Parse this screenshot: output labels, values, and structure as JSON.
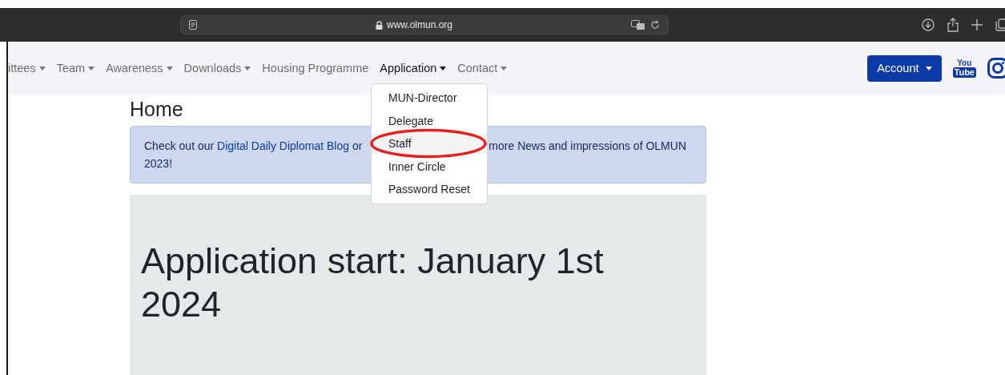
{
  "browser": {
    "url": "www.olmun.org"
  },
  "nav": {
    "items": [
      {
        "label": "ittees",
        "kind": "dropdown",
        "selected": false
      },
      {
        "label": "Team",
        "kind": "dropdown",
        "selected": false
      },
      {
        "label": "Awareness",
        "kind": "dropdown",
        "selected": false
      },
      {
        "label": "Downloads",
        "kind": "dropdown",
        "selected": false
      },
      {
        "label": "Housing Programme",
        "kind": "link",
        "selected": false
      },
      {
        "label": "Application",
        "kind": "dropdown",
        "selected": true
      },
      {
        "label": "Contact",
        "kind": "dropdown",
        "selected": false
      }
    ],
    "account_button": "Account",
    "youtube_logo": [
      "You",
      "Tube"
    ]
  },
  "dropdown": {
    "items": [
      {
        "label": "MUN-Director",
        "selected": false
      },
      {
        "label": "Delegate",
        "selected": false
      },
      {
        "label": "Staff",
        "selected": true
      },
      {
        "label": "Inner Circle",
        "selected": false
      },
      {
        "label": "Password Reset",
        "selected": false
      }
    ]
  },
  "page": {
    "heading": "Home",
    "alert": {
      "before": "Check out our ",
      "link": "Digital Daily Diplomat Blog",
      "middle": " or",
      "after": "more News and impressions of OLMUN",
      "after_wrap": "2023!"
    },
    "jumbotron_title": "Application start: January 1st 2024"
  }
}
